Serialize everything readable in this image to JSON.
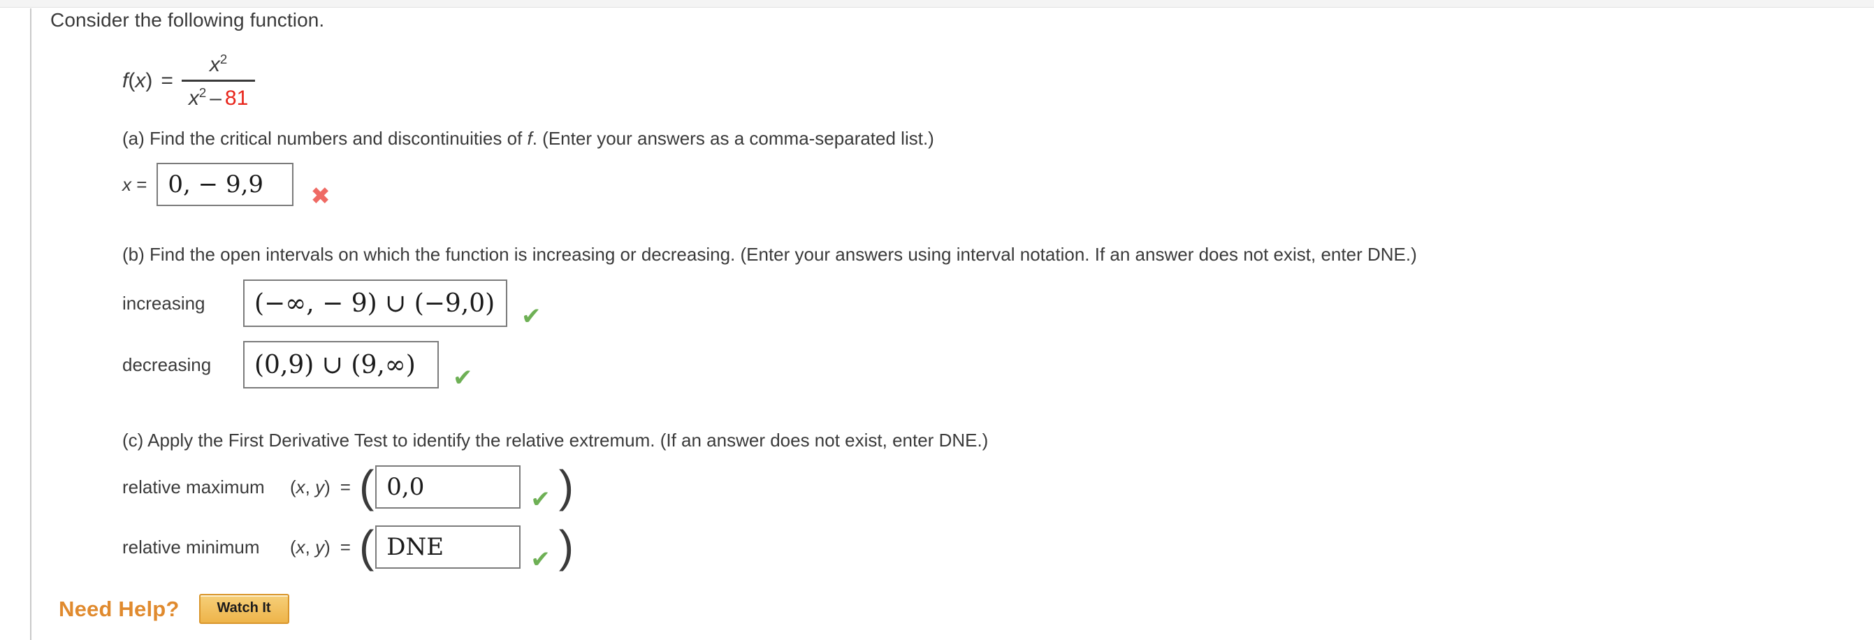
{
  "problem": {
    "intro": "Consider the following function.",
    "function": {
      "lhs": "f(x)",
      "equals": "=",
      "numerator_base": "x",
      "numerator_exponent": "2",
      "denominator_base": "x",
      "denominator_exponent": "2",
      "denominator_operator": "–",
      "denominator_constant": "81",
      "constant_color": "#e8251b"
    }
  },
  "parts": {
    "a": {
      "prompt": "(a) Find the critical numbers and discontinuities of f. (Enter your answers as a comma-separated list.)",
      "prompt_pre": "(a) Find the critical numbers and discontinuities of ",
      "prompt_italic": "f",
      "prompt_post": ". (Enter your answers as a comma-separated list.)",
      "var_label": "x",
      "equals": "=",
      "answer": "0, − 9,9",
      "status": "incorrect",
      "status_icon": "cross-icon",
      "status_glyph": "✖"
    },
    "b": {
      "prompt": "(b) Find the open intervals on which the function is increasing or decreasing. (Enter your answers using interval notation. If an answer does not exist, enter DNE.)",
      "increasing_label": "increasing",
      "increasing_answer": "(−∞, − 9) ∪ (−9,0)",
      "increasing_status": "correct",
      "decreasing_label": "decreasing",
      "decreasing_answer": "(0,9) ∪ (9,∞)",
      "decreasing_status": "correct",
      "status_glyph": "✔"
    },
    "c": {
      "prompt": "(c) Apply the First Derivative Test to identify the relative extremum. (If an answer does not exist, enter DNE.)",
      "max_label": "relative maximum",
      "max_coord_label": "(x, y)",
      "max_equals": "=",
      "max_answer": "0,0",
      "max_status": "correct",
      "min_label": "relative minimum",
      "min_coord_label": "(x, y)",
      "min_equals": "=",
      "min_answer": "DNE",
      "min_status": "correct",
      "open_paren": "(",
      "close_paren": ")",
      "status_glyph": "✔"
    }
  },
  "help": {
    "title": "Need Help?",
    "watch_button": "Watch It",
    "title_color": "#e08a2e",
    "button_color": "#eeb44a"
  }
}
